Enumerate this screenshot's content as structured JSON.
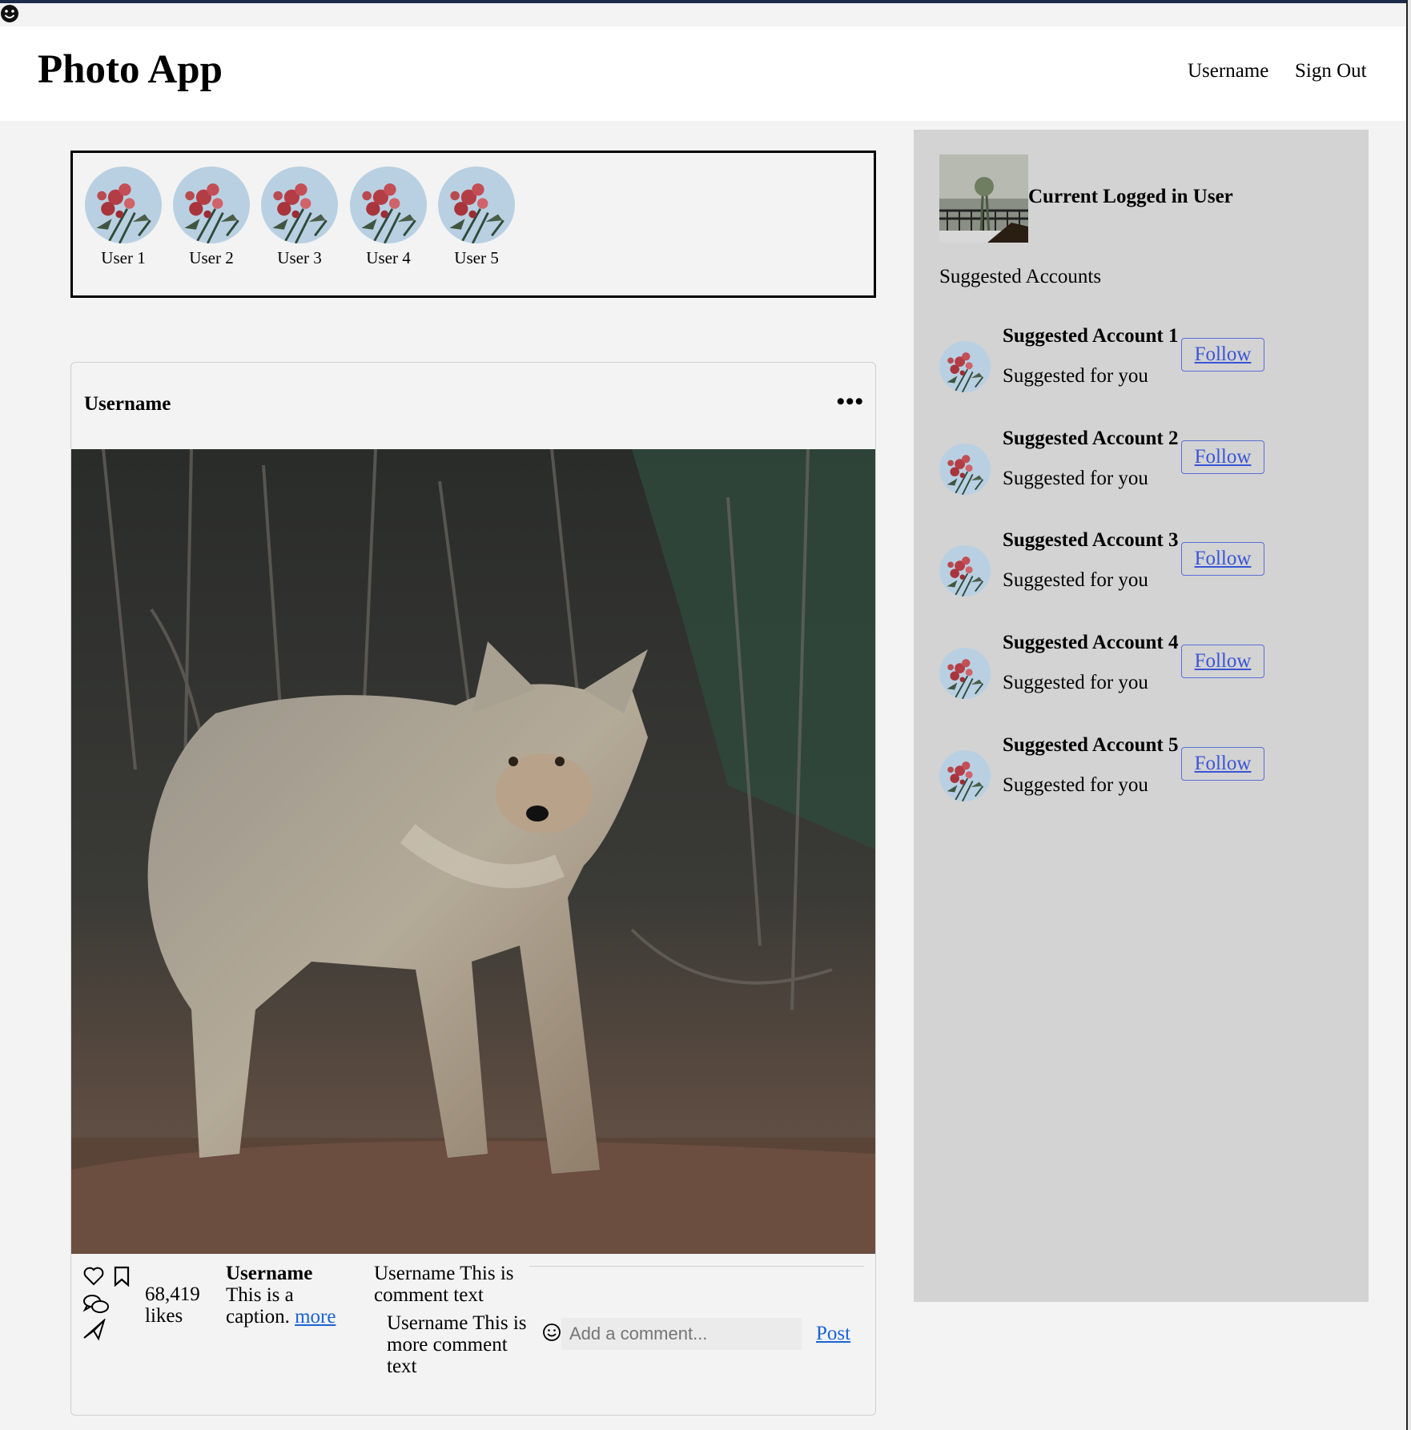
{
  "navbar": {
    "title": "Photo App",
    "username_link": "Username",
    "signout_link": "Sign Out"
  },
  "stories": [
    {
      "label": "User 1"
    },
    {
      "label": "User 2"
    },
    {
      "label": "User 3"
    },
    {
      "label": "User 4"
    },
    {
      "label": "User 5"
    }
  ],
  "post": {
    "username": "Username",
    "menu_icon": "ellipsis-icon",
    "likes_count": "68,419",
    "likes_label": "likes",
    "caption_user": "Username",
    "caption_text": "This is a caption.",
    "caption_more": "more",
    "comments": [
      {
        "text": "Username This is comment text"
      },
      {
        "text": "Username This is more comment text"
      }
    ],
    "comment_placeholder": "Add a comment...",
    "post_button": "Post",
    "action_icons": [
      "heart-icon",
      "bookmark-icon",
      "comment-icon",
      "send-icon"
    ]
  },
  "sidebar": {
    "current_user": "Current Logged in User",
    "suggested_title": "Suggested Accounts",
    "suggestions": [
      {
        "name": "Suggested Account 1",
        "sub": "Suggested for you",
        "button": "Follow"
      },
      {
        "name": "Suggested Account 2",
        "sub": "Suggested for you",
        "button": "Follow"
      },
      {
        "name": "Suggested Account 3",
        "sub": "Suggested for you",
        "button": "Follow"
      },
      {
        "name": "Suggested Account 4",
        "sub": "Suggested for you",
        "button": "Follow"
      },
      {
        "name": "Suggested Account 5",
        "sub": "Suggested for you",
        "button": "Follow"
      }
    ]
  },
  "colors": {
    "link": "#1a62d6",
    "follow_border": "#5a6ed8",
    "sidebar_bg": "#d3d3d3",
    "page_bg": "#f3f3f3"
  }
}
